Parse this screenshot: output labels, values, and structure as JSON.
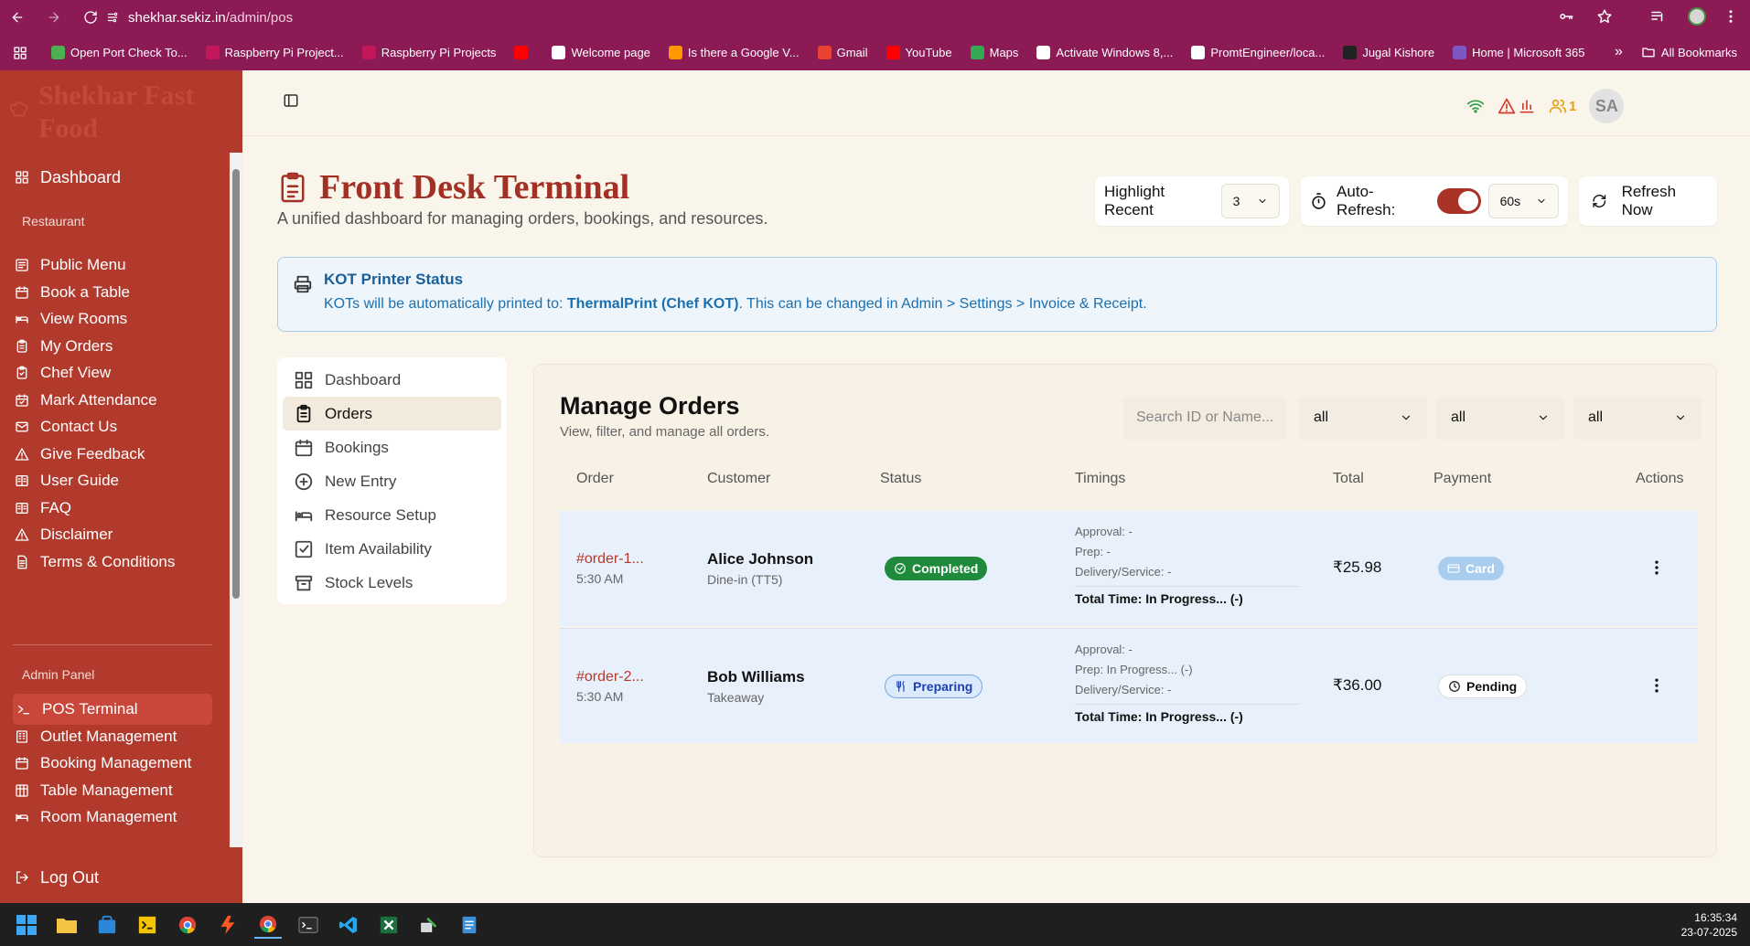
{
  "browser": {
    "url_host": "shekhar.sekiz.in",
    "url_path": "/admin/pos",
    "bookmarks": [
      {
        "label": "Open Port Check To...",
        "color": "#4caf50"
      },
      {
        "label": "Raspberry Pi Project...",
        "color": "#c2185b"
      },
      {
        "label": "Raspberry Pi Projects",
        "color": "#c2185b"
      },
      {
        "label": "",
        "color": "#ff0000"
      },
      {
        "label": "Welcome page",
        "color": "#ffffff"
      },
      {
        "label": "Is there a Google V...",
        "color": "#ff9800"
      },
      {
        "label": "Gmail",
        "color": "#ea4335"
      },
      {
        "label": "YouTube",
        "color": "#ff0000"
      },
      {
        "label": "Maps",
        "color": "#34a853"
      },
      {
        "label": "Activate Windows 8,...",
        "color": "#ffffff"
      },
      {
        "label": "PromtEngineer/loca...",
        "color": "#ffffff"
      },
      {
        "label": "Jugal Kishore",
        "color": "#222222"
      },
      {
        "label": "Home | Microsoft 365",
        "color": "#7e57c2"
      }
    ],
    "all_bookmarks": "All Bookmarks"
  },
  "sidebar": {
    "brand": "Shekhar Fast Food",
    "dashboard": "Dashboard",
    "section_restaurant": "Restaurant",
    "restaurant_items": [
      "Public Menu",
      "Book a Table",
      "View Rooms",
      "My Orders",
      "Chef View",
      "Mark Attendance",
      "Contact Us",
      "Give Feedback",
      "User Guide",
      "FAQ",
      "Disclaimer",
      "Terms & Conditions"
    ],
    "section_admin": "Admin Panel",
    "admin_items": [
      "POS Terminal",
      "Outlet Management",
      "Booking Management",
      "Table Management",
      "Room Management"
    ],
    "logout": "Log Out"
  },
  "topbar": {
    "notif_count": "1",
    "avatar": "SA"
  },
  "header": {
    "title": "Front Desk Terminal",
    "subtitle": "A unified dashboard for managing orders, bookings, and resources.",
    "highlight_label": "Highlight Recent",
    "highlight_value": "3",
    "autorefresh_label": "Auto-Refresh:",
    "autorefresh_on": true,
    "interval": "60s",
    "refresh_now": "Refresh Now"
  },
  "kot": {
    "title": "KOT Printer Status",
    "desc_prefix": "KOTs will be automatically printed to: ",
    "printer": "ThermalPrint (Chef KOT)",
    "desc_suffix": ". This can be changed in Admin > Settings > Invoice & Receipt."
  },
  "subnav": [
    "Dashboard",
    "Orders",
    "Bookings",
    "New Entry",
    "Resource Setup",
    "Item Availability",
    "Stock Levels"
  ],
  "orders": {
    "title": "Manage Orders",
    "subtitle": "View, filter, and manage all orders.",
    "search_placeholder": "Search ID or Name...",
    "filters": [
      "all",
      "all",
      "all"
    ],
    "columns": [
      "Order",
      "Customer",
      "Status",
      "Timings",
      "Total",
      "Payment",
      "Actions"
    ],
    "rows": [
      {
        "id": "#order-1...",
        "time": "5:30 AM",
        "customer": "Alice Johnson",
        "type": "Dine-in (TT5)",
        "status": "Completed",
        "approval": "Approval: -",
        "prep": "Prep: -",
        "delivery": "Delivery/Service: -",
        "total_time": "Total Time: In Progress... (-)",
        "total": "₹25.98",
        "payment": "Card"
      },
      {
        "id": "#order-2...",
        "time": "5:30 AM",
        "customer": "Bob Williams",
        "type": "Takeaway",
        "status": "Preparing",
        "approval": "Approval: -",
        "prep": "Prep: In Progress... (-)",
        "delivery": "Delivery/Service: -",
        "total_time": "Total Time: In Progress... (-)",
        "total": "₹36.00",
        "payment": "Pending"
      }
    ]
  },
  "taskbar": {
    "time": "16:35:34",
    "date": "23-07-2025"
  }
}
